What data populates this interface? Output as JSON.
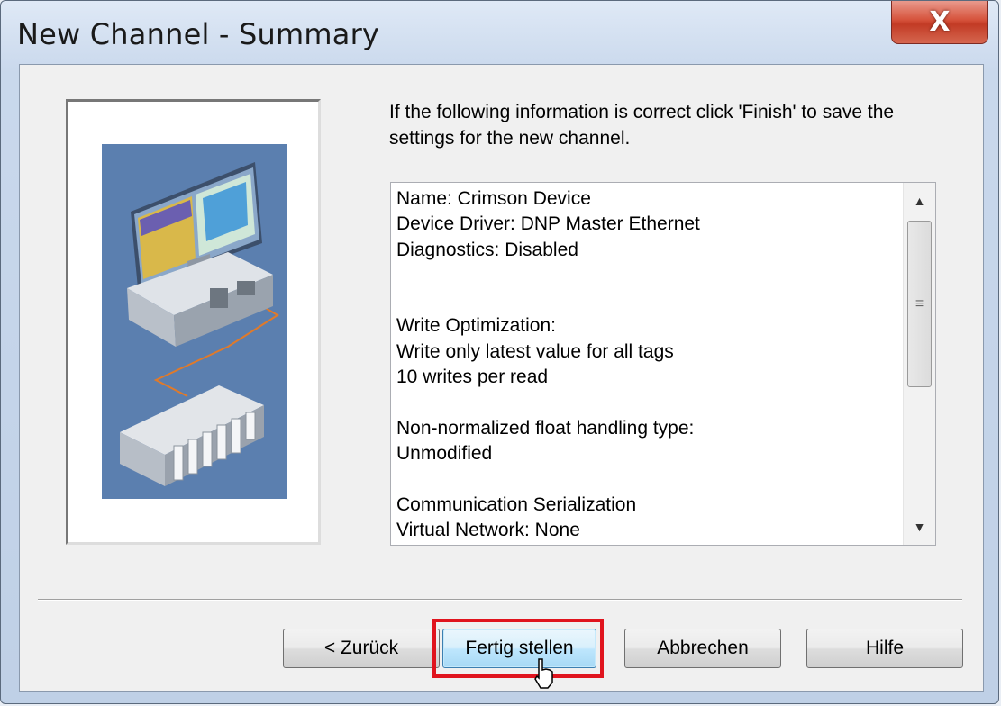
{
  "window": {
    "title": "New Channel - Summary",
    "close_label": "X"
  },
  "intro_text": "If the following information is correct click 'Finish' to save the settings for the new channel.",
  "summary": {
    "lines": [
      "Name: Crimson Device",
      "Device Driver: DNP Master Ethernet",
      "Diagnostics: Disabled",
      "",
      "",
      "Write Optimization:",
      "Write only latest value for all tags",
      "10 writes per read",
      "",
      "Non-normalized float handling type:",
      "Unmodified",
      "",
      "Communication Serialization",
      "Virtual Network: None"
    ]
  },
  "buttons": {
    "back_label": "< Zurück",
    "finish_label": "Fertig stellen",
    "cancel_label": "Abbrechen",
    "help_label": "Hilfe"
  },
  "colors": {
    "highlight": "#e0141e",
    "illustration_bg": "#5b7faf"
  }
}
